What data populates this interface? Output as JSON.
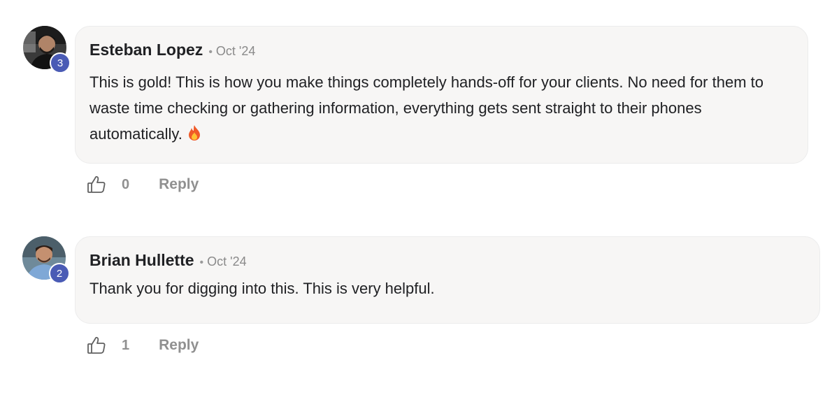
{
  "comments": [
    {
      "author": "Esteban Lopez",
      "separator": "•",
      "date": "Oct '24",
      "level": "3",
      "text": "This is gold! This is how you make things completely hands-off for your clients. No need for them to waste time checking or gathering information, everything gets sent straight to their phones automatically.",
      "emoji_icon": "fire-emoji-icon",
      "likes": "0",
      "reply_label": "Reply"
    },
    {
      "author": "Brian Hullette",
      "separator": "•",
      "date": "Oct '24",
      "level": "2",
      "text": "Thank you for digging into this. This is very helpful.",
      "likes": "1",
      "reply_label": "Reply"
    }
  ],
  "colors": {
    "badge": "#4a5bb5",
    "bubble_bg": "#f7f6f5",
    "muted_text": "#909090"
  }
}
